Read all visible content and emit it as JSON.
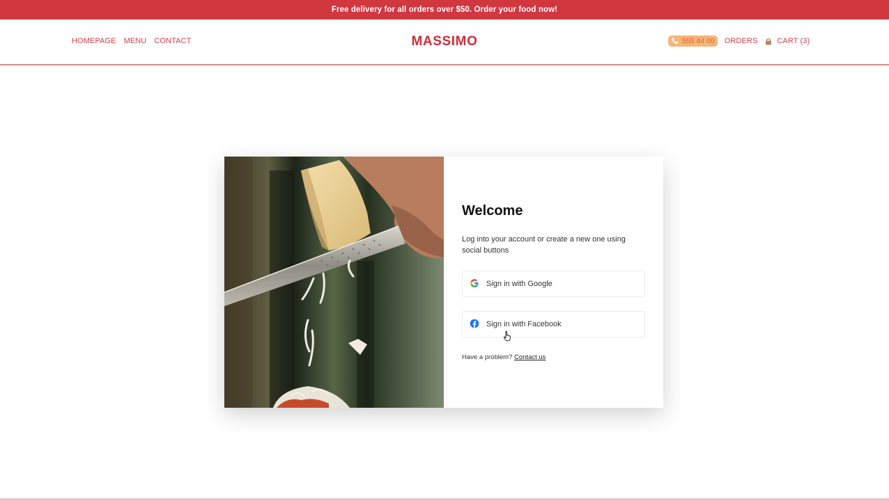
{
  "promo": {
    "text": "Free delivery for all orders over $50. Order your food now!"
  },
  "header": {
    "nav": [
      {
        "label": "HOMEPAGE"
      },
      {
        "label": "MENU"
      },
      {
        "label": "CONTACT"
      }
    ],
    "logo": "MASSIMO",
    "phone": "555 44 00",
    "orders_label": "ORDERS",
    "cart_label": "CART (3)"
  },
  "login": {
    "title": "Welcome",
    "subtitle": "Log into your account or create a new one using social buttons",
    "google_label": "Sign in with Google",
    "facebook_label": "Sign in with Facebook",
    "help_text": "Have a problem?",
    "help_link": "Contact us"
  },
  "colors": {
    "brand": "#d0373f",
    "accent": "#f5b577"
  },
  "icons": [
    "phone-icon",
    "cart-icon",
    "google-icon",
    "facebook-icon",
    "cursor-icon"
  ]
}
